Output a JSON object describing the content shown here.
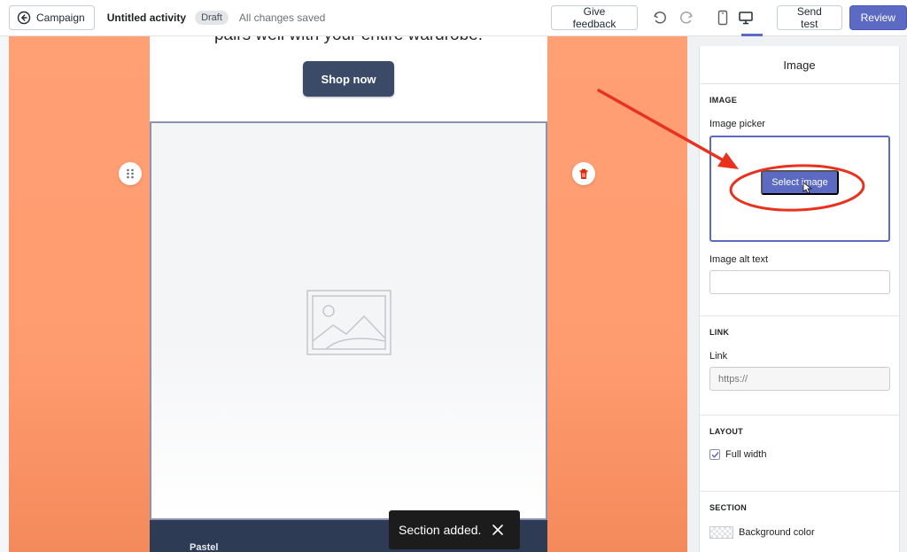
{
  "topbar": {
    "back_label": "Campaign",
    "activity_title": "Untitled activity",
    "status_badge": "Draft",
    "save_status": "All changes saved",
    "feedback_label": "Give feedback",
    "send_test_label": "Send test",
    "review_label": "Review",
    "icons": [
      "arrow-left-circle-icon",
      "undo-icon",
      "redo-icon",
      "mobile-device-icon",
      "desktop-device-icon"
    ],
    "selected_device": "desktop",
    "accent_color": "#5c6ac4"
  },
  "canvas": {
    "background_color": "#ff9f74",
    "headline": "pairs well with your entire wardrobe.",
    "cta_label": "Shop now",
    "footer_label": "Pastel",
    "section_icons": [
      "drag-dots-icon",
      "trash-icon",
      "image-placeholder-icon"
    ]
  },
  "toast": {
    "message": "Section added.",
    "icon": "close-icon"
  },
  "panel": {
    "title": "Image",
    "image_section": {
      "heading": "IMAGE",
      "picker_label": "Image picker",
      "select_button": "Select image",
      "alt_label": "Image alt text",
      "alt_value": ""
    },
    "link_section": {
      "heading": "LINK",
      "label": "Link",
      "placeholder": "https://"
    },
    "layout_section": {
      "heading": "LAYOUT",
      "full_width_label": "Full width",
      "full_width_checked": true
    },
    "section_section": {
      "heading": "SECTION",
      "bg_color_label": "Background color"
    }
  },
  "annotation": {
    "color": "#e8321e"
  }
}
